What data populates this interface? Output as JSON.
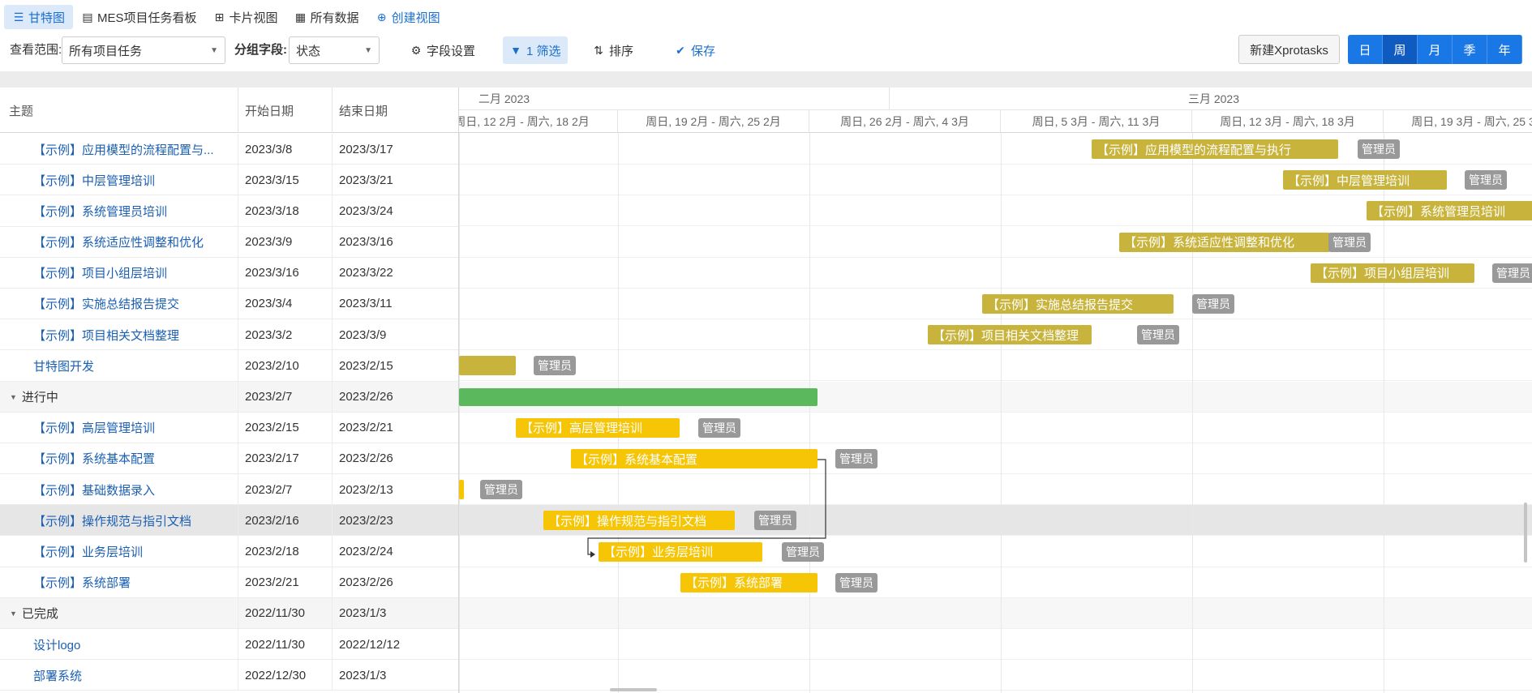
{
  "view_tabs": [
    {
      "label": "甘特图",
      "icon": "gantt-icon",
      "active": true
    },
    {
      "label": "MES项目任务看板",
      "icon": "kanban-icon",
      "active": false
    },
    {
      "label": "卡片视图",
      "icon": "card-icon",
      "active": false
    },
    {
      "label": "所有数据",
      "icon": "table-icon",
      "active": false
    },
    {
      "label": "创建视图",
      "icon": "plus-icon",
      "active": false
    }
  ],
  "toolbar": {
    "scope_label": "查看范围:",
    "scope_value": "所有项目任务",
    "group_label": "分组字段:",
    "group_value": "状态",
    "field_settings": "字段设置",
    "filter": "1 筛选",
    "sort": "排序",
    "save": "保存",
    "new_button": "新建Xprotasks",
    "scales": [
      "日",
      "周",
      "月",
      "季",
      "年"
    ],
    "active_scale": "周"
  },
  "grid": {
    "columns": [
      "主题",
      "开始日期",
      "结束日期"
    ],
    "rows": [
      {
        "title": "【示例】应用模型的流程配置与...",
        "start": "2023/3/8",
        "end": "2023/3/17"
      },
      {
        "title": "【示例】中层管理培训",
        "start": "2023/3/15",
        "end": "2023/3/21"
      },
      {
        "title": "【示例】系统管理员培训",
        "start": "2023/3/18",
        "end": "2023/3/24"
      },
      {
        "title": "【示例】系统适应性调整和优化",
        "start": "2023/3/9",
        "end": "2023/3/16"
      },
      {
        "title": "【示例】项目小组层培训",
        "start": "2023/3/16",
        "end": "2023/3/22"
      },
      {
        "title": "【示例】实施总结报告提交",
        "start": "2023/3/4",
        "end": "2023/3/11"
      },
      {
        "title": "【示例】项目相关文档整理",
        "start": "2023/3/2",
        "end": "2023/3/9"
      },
      {
        "title": "甘特图开发",
        "start": "2023/2/10",
        "end": "2023/2/15"
      },
      {
        "title": "进行中",
        "start": "2023/2/7",
        "end": "2023/2/26",
        "group": true
      },
      {
        "title": "【示例】高层管理培训",
        "start": "2023/2/15",
        "end": "2023/2/21"
      },
      {
        "title": "【示例】系统基本配置",
        "start": "2023/2/17",
        "end": "2023/2/26"
      },
      {
        "title": "【示例】基础数据录入",
        "start": "2023/2/7",
        "end": "2023/2/13"
      },
      {
        "title": "【示例】操作规范与指引文档",
        "start": "2023/2/16",
        "end": "2023/2/23",
        "selected": true
      },
      {
        "title": "【示例】业务层培训",
        "start": "2023/2/18",
        "end": "2023/2/24"
      },
      {
        "title": "【示例】系统部署",
        "start": "2023/2/21",
        "end": "2023/2/26"
      },
      {
        "title": "已完成",
        "start": "2022/11/30",
        "end": "2023/1/3",
        "group": true
      },
      {
        "title": "设计logo",
        "start": "2022/11/30",
        "end": "2022/12/12"
      },
      {
        "title": "部署系统",
        "start": "2022/12/30",
        "end": "2023/1/3"
      }
    ]
  },
  "timeline": {
    "months": [
      "二月 2023",
      "三月 2023"
    ],
    "weeks": [
      "周日, 12 2月 - 周六, 18 2月",
      "周日, 19 2月 - 周六, 25 2月",
      "周日, 26 2月 - 周六, 4 3月",
      "周日, 5 3月 - 周六, 11 3月",
      "周日, 12 3月 - 周六, 18 3月",
      "周日, 19 3月 - 周六, 25 3月"
    ]
  },
  "bars": [
    {
      "label": "【示例】应用模型的流程配置与执行",
      "assignee": "管理员",
      "color": "olive"
    },
    {
      "label": "【示例】中层管理培训",
      "assignee": "管理员",
      "color": "olive"
    },
    {
      "label": "【示例】系统管理员培训",
      "assignee": "",
      "color": "olive"
    },
    {
      "label": "【示例】系统适应性调整和优化",
      "assignee": "管理员",
      "color": "olive"
    },
    {
      "label": "【示例】项目小组层培训",
      "assignee": "管理员",
      "color": "olive"
    },
    {
      "label": "【示例】实施总结报告提交",
      "assignee": "管理员",
      "color": "olive"
    },
    {
      "label": "【示例】项目相关文档整理",
      "assignee": "管理员",
      "color": "olive"
    },
    {
      "label": "",
      "assignee": "管理员",
      "color": "olive"
    },
    {
      "label": "",
      "assignee": "",
      "color": "green"
    },
    {
      "label": "【示例】高层管理培训",
      "assignee": "管理员",
      "color": "gold"
    },
    {
      "label": "【示例】系统基本配置",
      "assignee": "管理员",
      "color": "gold"
    },
    {
      "label": "",
      "assignee": "管理员",
      "color": "gold"
    },
    {
      "label": "【示例】操作规范与指引文档",
      "assignee": "管理员",
      "color": "gold"
    },
    {
      "label": "【示例】业务层培训",
      "assignee": "管理员",
      "color": "gold"
    },
    {
      "label": "【示例】系统部署",
      "assignee": "管理员",
      "color": "gold"
    }
  ],
  "colors": {
    "accent": "#1a78e6",
    "olive": "#c8b43c",
    "gold": "#f5c506",
    "green": "#5cb85c",
    "tag": "#999999"
  }
}
